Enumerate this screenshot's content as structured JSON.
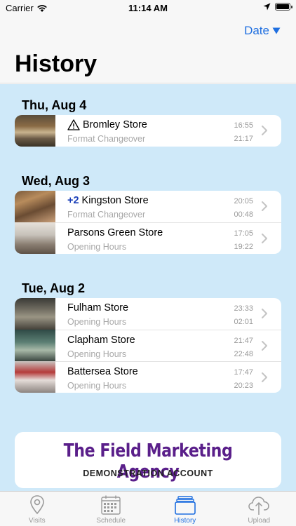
{
  "status_bar": {
    "carrier": "Carrier",
    "time": "11:14 AM",
    "battery_level": 1.0
  },
  "header": {
    "sort_label": "Date",
    "sort_icon": "triangle-down-icon",
    "title": "History"
  },
  "sections": [
    {
      "date": "Thu, Aug 4",
      "visits": [
        {
          "prefix": "",
          "warning": true,
          "store": "Bromley Store",
          "type": "Format Changeover",
          "start": "16:55",
          "end": "21:17",
          "thumb": "bromley"
        }
      ]
    },
    {
      "date": "Wed, Aug 3",
      "visits": [
        {
          "prefix": "+2",
          "warning": false,
          "store": "Kingston Store",
          "type": "Format Changeover",
          "start": "20:05",
          "end": "00:48",
          "thumb": "kingston"
        },
        {
          "prefix": "",
          "warning": false,
          "store": "Parsons Green Store",
          "type": "Opening Hours",
          "start": "17:05",
          "end": "19:22",
          "thumb": "parsons"
        }
      ]
    },
    {
      "date": "Tue, Aug 2",
      "visits": [
        {
          "prefix": "",
          "warning": false,
          "store": "Fulham Store",
          "type": "Opening Hours",
          "start": "23:33",
          "end": "02:01",
          "thumb": "fulham"
        },
        {
          "prefix": "",
          "warning": false,
          "store": "Clapham Store",
          "type": "Opening Hours",
          "start": "21:47",
          "end": "22:48",
          "thumb": "clapham"
        },
        {
          "prefix": "",
          "warning": false,
          "store": "Battersea Store",
          "type": "Opening Hours",
          "start": "17:47",
          "end": "20:23",
          "thumb": "battersea"
        }
      ]
    }
  ],
  "banner": {
    "title": "The Field Marketing Agency",
    "subtitle": "DEMONSTRATION ACCOUNT"
  },
  "tabs": [
    {
      "label": "Visits",
      "icon": "location-pin-icon",
      "active": false
    },
    {
      "label": "Schedule",
      "icon": "calendar-icon",
      "active": false
    },
    {
      "label": "History",
      "icon": "stacked-folders-icon",
      "active": true
    },
    {
      "label": "Upload",
      "icon": "cloud-upload-icon",
      "active": false
    }
  ],
  "colors": {
    "accent": "#1f6fe0",
    "content_background": "#cfe9f9",
    "banner_title": "#5a1f8a",
    "plus_badge": "#1a3fb8"
  }
}
